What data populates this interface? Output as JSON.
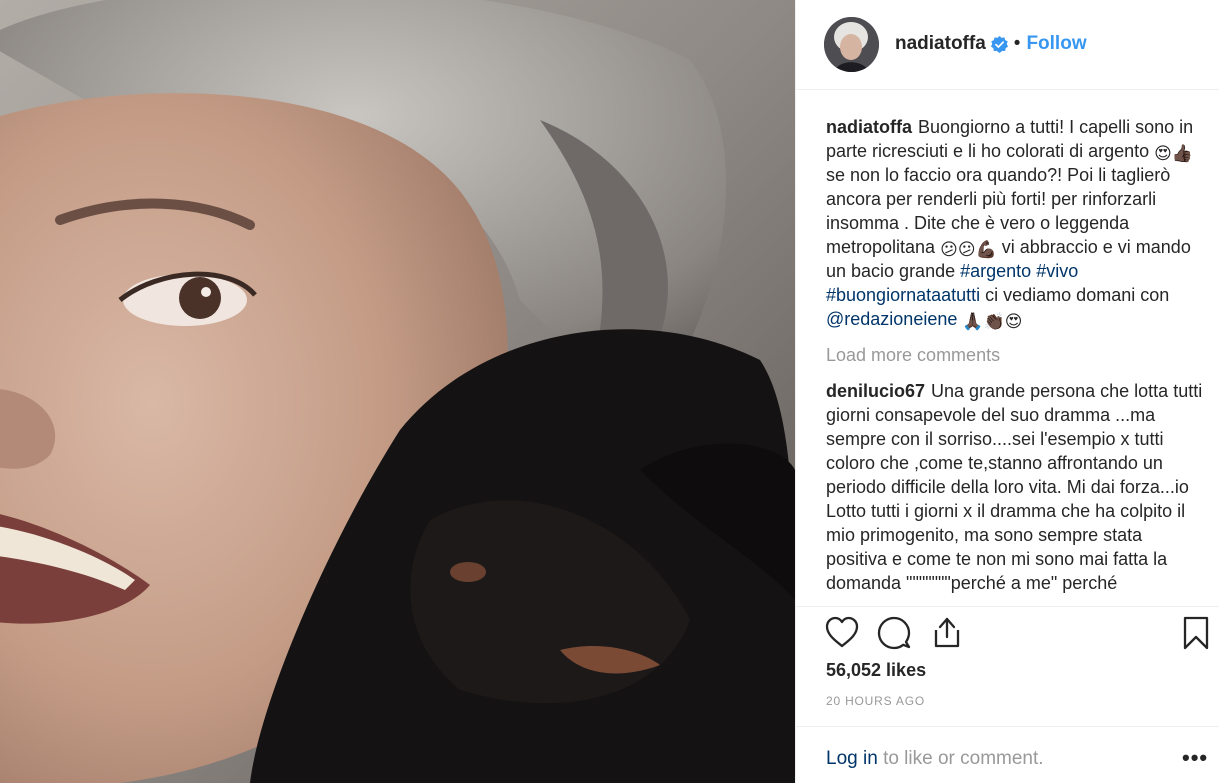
{
  "post": {
    "username": "nadiatoffa",
    "follow_label": "Follow",
    "separator": "•",
    "caption": {
      "username": "nadiatoffa",
      "text_1": "Buongiorno a tutti! I capelli sono in parte ricresciuti e li ho colorati di argento",
      "emoji_1": "😍👍🏿",
      "text_2": "se non lo faccio ora quando?! Poi li taglierò ancora per renderli più forti! per rinforzarli insomma . Dite che è vero o leggenda metropolitana",
      "emoji_2": "😕😕💪🏿",
      "text_3": "vi abbraccio e vi mando un bacio grande",
      "hashtags": [
        "#argento",
        "#vivo",
        "#buongiornataatutti"
      ],
      "text_4": "ci vediamo domani con",
      "mention": "@redazioneiene",
      "emoji_3": "🙏🏿👏🏿😍"
    },
    "load_more_label": "Load more comments",
    "comments": [
      {
        "username": "denilucio67",
        "text": "Una grande persona che lotta tutti giorni consapevole del suo dramma ...ma sempre con il sorriso....sei l'esempio x tutti coloro che ,come te,stanno affrontando un periodo difficile della loro vita. Mi dai forza...io Lotto tutti i giorni x il dramma che ha colpito il mio primogenito, ma sono sempre stata positiva e come te non mi sono mai fatta la domanda \"\"\"\"\"\"\"perché a me\" perché"
      }
    ],
    "likes": "56,052 likes",
    "timestamp": "20 HOURS AGO",
    "footer": {
      "login_link": "Log in",
      "login_text": "to like or comment.",
      "more_label": "•••"
    }
  },
  "icons": {
    "like": "heart-icon",
    "comment": "comment-bubble-icon",
    "share": "share-icon",
    "save": "bookmark-icon",
    "verified": "verified-badge-icon"
  },
  "colors": {
    "link_blue": "#3897f0",
    "hashtag": "#003569",
    "muted": "#999999",
    "text": "#262626"
  }
}
